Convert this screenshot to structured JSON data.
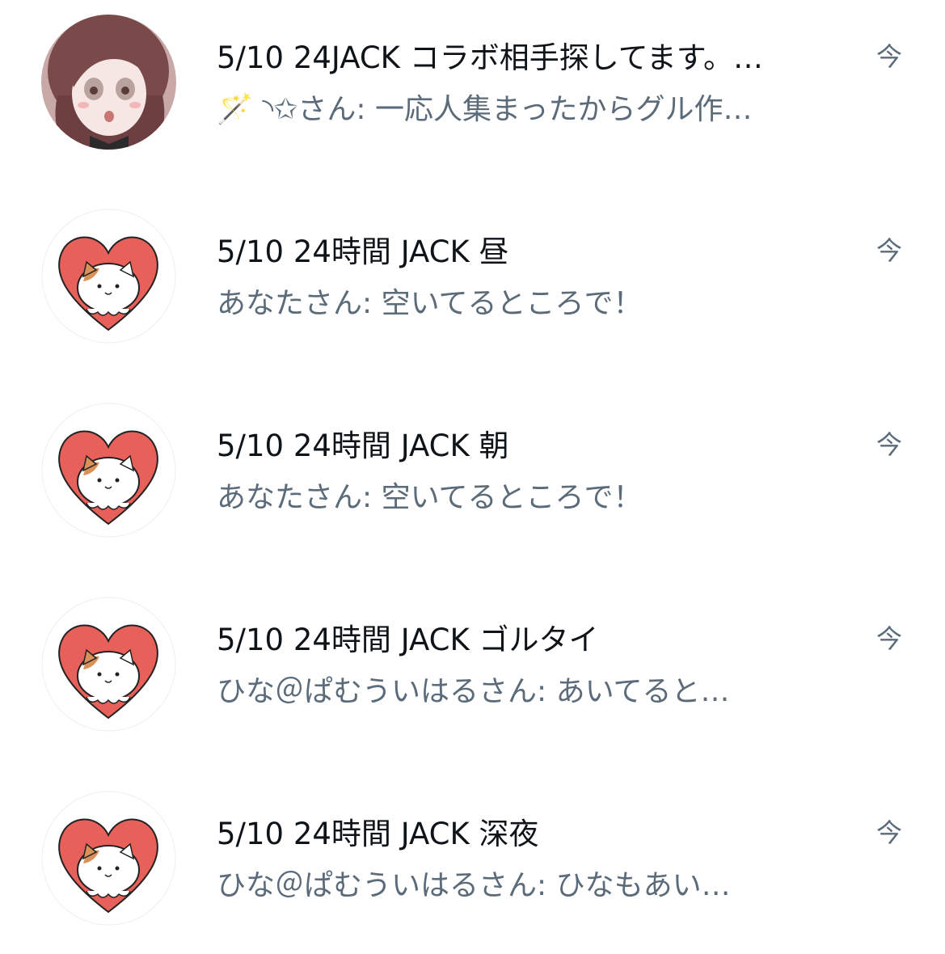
{
  "threads": [
    {
      "title": "5/10 24JACK コラボ相手探してます。…",
      "preview": "🪄 ◝✩さん: 一応人集まったからグル作…",
      "time": "今",
      "avatar": "anime-girl-avatar"
    },
    {
      "title": "5/10 24時間 JACK 昼",
      "preview": "あなたさん: 空いてるところで！",
      "time": "今",
      "avatar": "cat-heart-avatar"
    },
    {
      "title": "5/10 24時間 JACK 朝",
      "preview": "あなたさん: 空いてるところで！",
      "time": "今",
      "avatar": "cat-heart-avatar"
    },
    {
      "title": "5/10 24時間 JACK ゴルタイ",
      "preview": "ひな＠ぱむういはるさん: あいてると…",
      "time": "今",
      "avatar": "cat-heart-avatar"
    },
    {
      "title": "5/10 24時間 JACK 深夜",
      "preview": "ひな＠ぱむういはるさん: ひなもあい…",
      "time": "今",
      "avatar": "cat-heart-avatar"
    }
  ],
  "colors": {
    "title_text": "#0f1419",
    "secondary_text": "#5b6b7a",
    "heart_red": "#e8605a",
    "hair_brown": "#7a4a4a"
  }
}
